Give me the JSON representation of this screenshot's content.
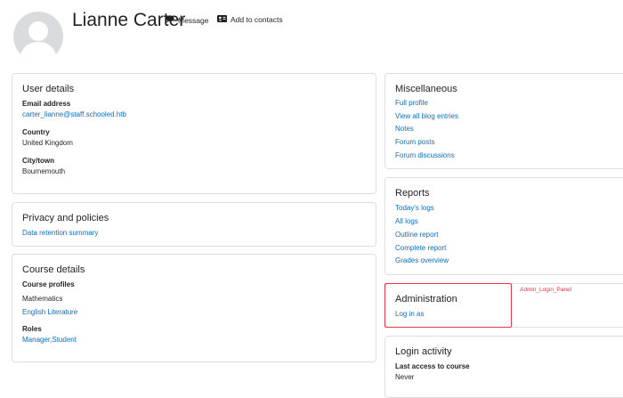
{
  "header": {
    "name": "Lianne Carter",
    "message_label": "Message",
    "add_contacts_label": "Add to contacts"
  },
  "user_details": {
    "title": "User details",
    "email_label": "Email address",
    "email_value": "carter_lianne@staff.schooled.htb",
    "country_label": "Country",
    "country_value": "United Kingdom",
    "city_label": "City/town",
    "city_value": "Bournemouth"
  },
  "privacy": {
    "title": "Privacy and policies",
    "link": "Data retention summary"
  },
  "course_details": {
    "title": "Course details",
    "profiles_label": "Course profiles",
    "courses": [
      "Mathematics",
      "English Literature"
    ],
    "roles_label": "Roles",
    "roles_value": "Manager,Student"
  },
  "misc": {
    "title": "Miscellaneous",
    "links": [
      "Full profile",
      "View all blog entries",
      "Notes",
      "Forum posts",
      "Forum discussions"
    ]
  },
  "reports": {
    "title": "Reports",
    "links": [
      "Today's logs",
      "All logs",
      "Outline report",
      "Complete report",
      "Grades overview"
    ]
  },
  "administration": {
    "title": "Administration",
    "link": "Log in as"
  },
  "annotation": {
    "label": "Admin_Login_Panel",
    "color": "#e63946"
  },
  "login_activity": {
    "title": "Login activity",
    "last_access_label": "Last access to course",
    "last_access_value": "Never"
  }
}
